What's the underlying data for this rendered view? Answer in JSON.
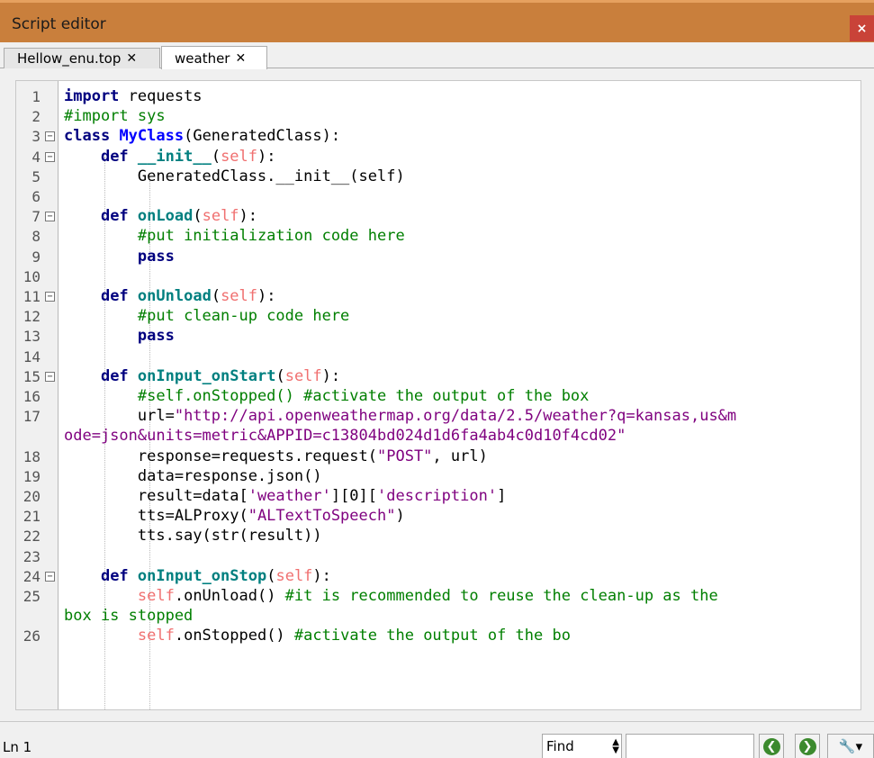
{
  "window": {
    "title": "Script editor",
    "close_label": "×"
  },
  "tabs": [
    {
      "label": "Hellow_enu.top",
      "close": "✕"
    },
    {
      "label": "weather",
      "close": "✕"
    }
  ],
  "status": {
    "cursor": "Ln 1",
    "find_label": "Find",
    "find_arrows": "▲▼",
    "prev_glyph": "❮",
    "next_glyph": "❯",
    "tools_glyph": "🔧▾"
  },
  "code_lines": [
    {
      "num": "1",
      "fold": "",
      "html": "<span class=\"kw\">import</span> requests"
    },
    {
      "num": "2",
      "fold": "",
      "html": "<span class=\"cm\">#import sys</span>"
    },
    {
      "num": "3",
      "fold": "−",
      "html": "<span class=\"kw\">class</span> <span class=\"cls\">MyClass</span>(GeneratedClass):"
    },
    {
      "num": "4",
      "fold": "−",
      "html": "    <span class=\"kw\">def</span> <span class=\"fn\">__init__</span>(<span class=\"self\">self</span>):"
    },
    {
      "num": "5",
      "fold": "",
      "html": "        GeneratedClass.__init__(self)"
    },
    {
      "num": "6",
      "fold": "",
      "html": ""
    },
    {
      "num": "7",
      "fold": "−",
      "html": "    <span class=\"kw\">def</span> <span class=\"fn\">onLoad</span>(<span class=\"self\">self</span>):"
    },
    {
      "num": "8",
      "fold": "",
      "html": "        <span class=\"cm\">#put initialization code here</span>"
    },
    {
      "num": "9",
      "fold": "",
      "html": "        <span class=\"kw\">pass</span>"
    },
    {
      "num": "10",
      "fold": "",
      "html": ""
    },
    {
      "num": "11",
      "fold": "−",
      "html": "    <span class=\"kw\">def</span> <span class=\"fn\">onUnload</span>(<span class=\"self\">self</span>):"
    },
    {
      "num": "12",
      "fold": "",
      "html": "        <span class=\"cm\">#put clean-up code here</span>"
    },
    {
      "num": "13",
      "fold": "",
      "html": "        <span class=\"kw\">pass</span>"
    },
    {
      "num": "14",
      "fold": "",
      "html": ""
    },
    {
      "num": "15",
      "fold": "−",
      "html": "    <span class=\"kw\">def</span> <span class=\"fn\">onInput_onStart</span>(<span class=\"self\">self</span>):"
    },
    {
      "num": "16",
      "fold": "",
      "html": "        <span class=\"cm\">#self.onStopped() #activate the output of the box</span>"
    },
    {
      "num": "17",
      "fold": "",
      "html": "        url=<span class=\"str\">\"http://api.openweathermap.org/data/2.5/weather?q=kansas,us&amp;m</span>"
    },
    {
      "num": "",
      "fold": "",
      "html": "<span class=\"str\">ode=json&amp;units=metric&amp;APPID=c13804bd024d1d6fa4ab4c0d10f4cd02\"</span>"
    },
    {
      "num": "18",
      "fold": "",
      "html": "        response=requests.request(<span class=\"str\">\"POST\"</span>, url)"
    },
    {
      "num": "19",
      "fold": "",
      "html": "        data=response.json()"
    },
    {
      "num": "20",
      "fold": "",
      "html": "        result=data[<span class=\"str\">'weather'</span>][0][<span class=\"str\">'description'</span>]"
    },
    {
      "num": "21",
      "fold": "",
      "html": "        tts=ALProxy(<span class=\"str\">\"ALTextToSpeech\"</span>)"
    },
    {
      "num": "22",
      "fold": "",
      "html": "        tts.say(str(result))"
    },
    {
      "num": "23",
      "fold": "",
      "html": ""
    },
    {
      "num": "24",
      "fold": "−",
      "html": "    <span class=\"kw\">def</span> <span class=\"fn\">onInput_onStop</span>(<span class=\"self\">self</span>):"
    },
    {
      "num": "25",
      "fold": "",
      "html": "        <span class=\"self\">self</span>.onUnload() <span class=\"cm\">#it is recommended to reuse the clean-up as the</span>"
    },
    {
      "num": "",
      "fold": "",
      "html": "<span class=\"cm\">box is stopped</span>"
    },
    {
      "num": "26",
      "fold": "",
      "html": "        <span class=\"self\">self</span>.onStopped() <span class=\"cm\">#activate the output of the bo</span>"
    }
  ]
}
